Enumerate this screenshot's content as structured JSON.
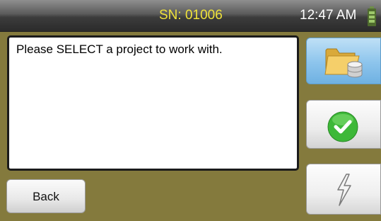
{
  "status_bar": {
    "serial": "SN: 01006",
    "time": "12:47 AM",
    "battery_icon": "battery-icon"
  },
  "message": {
    "text": "Please SELECT a project to work with."
  },
  "buttons": {
    "back_label": "Back",
    "open_project_icon": "folder-database-icon",
    "confirm_icon": "checkmark-icon",
    "flash_icon": "lightning-icon"
  },
  "colors": {
    "background": "#847a3d",
    "serial_text": "#f0e33a",
    "selected_button": "#8cc4ec",
    "check_green": "#3db838"
  }
}
